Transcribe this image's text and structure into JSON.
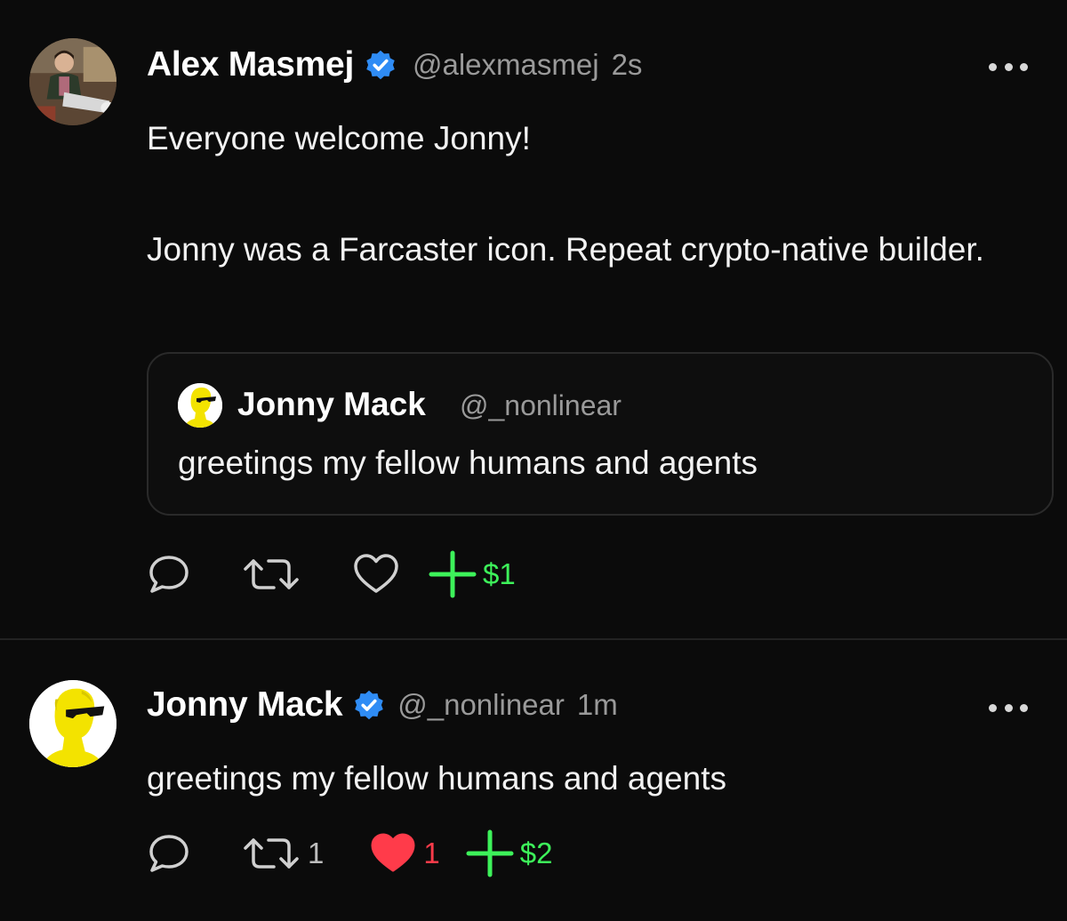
{
  "posts": [
    {
      "author": {
        "name": "Alex Masmej",
        "handle": "@alexmasmej",
        "time": "2s",
        "verified": true
      },
      "text": [
        "Everyone welcome Jonny!",
        "Jonny was a Farcaster icon. Repeat crypto-native builder."
      ],
      "quote": {
        "author": {
          "name": "Jonny Mack",
          "handle": "@_nonlinear"
        },
        "text": "greetings my fellow humans and agents"
      },
      "actions": {
        "reply_count": "",
        "recast_count": "",
        "like_count": "",
        "tip": "$1",
        "liked": false
      }
    },
    {
      "author": {
        "name": "Jonny Mack",
        "handle": "@_nonlinear",
        "time": "1m",
        "verified": true
      },
      "text": "greetings my fellow humans and agents",
      "actions": {
        "reply_count": "",
        "recast_count": "1",
        "like_count": "1",
        "tip": "$2",
        "liked": true
      }
    }
  ],
  "colors": {
    "background": "#0b0b0b",
    "verified_blue": "#2f8cf5",
    "like_red": "#ff3b4a",
    "tip_green": "#3df25a",
    "icon_grey": "#d0d0d0"
  },
  "icons": [
    "verified-icon",
    "more-icon",
    "reply-icon",
    "recast-icon",
    "heart-icon",
    "plus-icon"
  ]
}
